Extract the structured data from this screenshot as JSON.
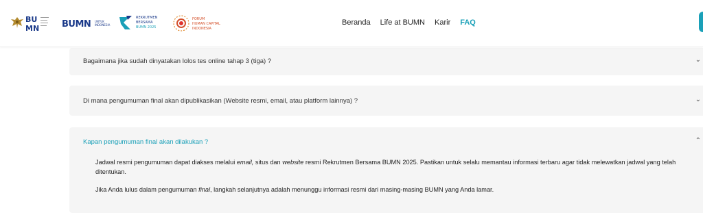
{
  "header": {
    "logos": {
      "garuda": "garuda-emblem-icon",
      "bumn": "BUMN",
      "bumn_untuk": "BUMN UNTUK INDONESIA",
      "rekrutmen": "REKRUTMEN BERSAMA BUMN 2025",
      "fhci": "FORUM HUMAN CAPITAL INDONESIA"
    },
    "nav": [
      {
        "label": "Beranda",
        "active": false
      },
      {
        "label": "Life at BUMN",
        "active": false
      },
      {
        "label": "Karir",
        "active": false
      },
      {
        "label": "FAQ",
        "active": true
      }
    ]
  },
  "faq": {
    "items": [
      {
        "question": "Bagaimana jika sudah dinyatakan lolos tes online tahap 3 (tiga) ?"
      },
      {
        "question": "Di mana pengumuman final akan dipublikasikan (Website resmi, email, atau platform lainnya) ?"
      },
      {
        "question": "Kapan pengumuman final akan dilakukan ?",
        "answer": {
          "p1_a": "Jadwal resmi pengumuman dapat diakses melalui ",
          "p1_b": "email,",
          "p1_c": " situs dan ",
          "p1_d": "website",
          "p1_e": " resmi Rekrutmen Bersama BUMN 2025. Pastikan untuk selalu memantau informasi terbaru agar tidak melewatkan jadwal yang telah ditentukan.",
          "p2_a": "Jika Anda lulus dalam pengumuman ",
          "p2_b": "final",
          "p2_c": ", langkah selanjutnya adalah menunggu informasi resmi dari masing-masing BUMN yang Anda lamar."
        }
      }
    ]
  },
  "colors": {
    "accent": "#1aa0b8",
    "card_bg": "#f5f5f5",
    "text": "#333333"
  }
}
